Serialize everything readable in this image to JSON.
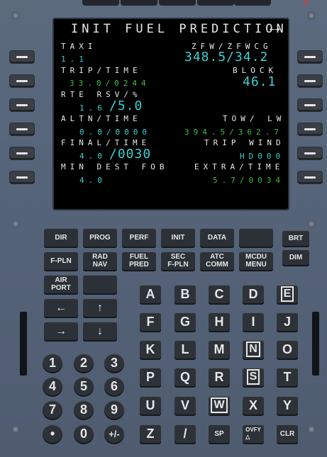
{
  "screen": {
    "title": "INIT FUEL PREDICTION",
    "title_arrow": "←→",
    "rows": [
      {
        "left_label": "TAXI",
        "left_value": "1.1",
        "right_label": "ZFW/ZFWCG",
        "right_value": "348.5/34.2"
      },
      {
        "left_label": "TRIP/TIME",
        "left_value": "33.0/0244",
        "right_label": "BLOCK",
        "right_value": "46.1"
      },
      {
        "left_label": "RTE RSV/%",
        "left_value_small": "1.6",
        "left_value_big": "/5.0",
        "right_label": "",
        "right_value": ""
      },
      {
        "left_label": "ALTN/TIME",
        "left_value": "0.0/0000",
        "right_label": "TOW/ LW",
        "right_value": "394.5/362.7"
      },
      {
        "left_label": "FINAL/TIME",
        "left_value_small": "4.0",
        "left_value_big": "/0030",
        "right_label": "TRIP WIND",
        "right_value": "HD000"
      },
      {
        "left_label": "MIN DEST FOB",
        "left_value": "4.0",
        "right_label": "EXTRA/TIME",
        "right_value": "5.7/0034"
      }
    ]
  },
  "function_keys": [
    [
      "DIR",
      "PROG",
      "PERF",
      "INIT",
      "DATA",
      ""
    ],
    [
      "F-PLN",
      "RAD\nNAV",
      "FUEL\nPRED",
      "SEC\nF-PLN",
      "ATC\nCOMM",
      "MCDU\nMENU"
    ],
    [
      "AIR\nPORT",
      ""
    ]
  ],
  "side_keys": [
    "BRT",
    "DIM"
  ],
  "arrow_keys": [
    "←",
    "↑",
    "→",
    "↓"
  ],
  "letter_keys": [
    "A",
    "B",
    "C",
    "D",
    "E",
    "F",
    "G",
    "H",
    "I",
    "J",
    "K",
    "L",
    "M",
    "N",
    "O",
    "P",
    "Q",
    "R",
    "S",
    "T",
    "U",
    "V",
    "W",
    "X",
    "Y",
    "Z",
    "/",
    "SP",
    "OVFY\n△",
    "CLR"
  ],
  "number_keys": [
    "1",
    "2",
    "3",
    "4",
    "5",
    "6",
    "7",
    "8",
    "9",
    "•",
    "0",
    "+/-"
  ],
  "colors": {
    "label": "#e8e8e8",
    "cyan": "#3bd1d1",
    "green": "#3fbf3f",
    "panel": "#56647a"
  }
}
